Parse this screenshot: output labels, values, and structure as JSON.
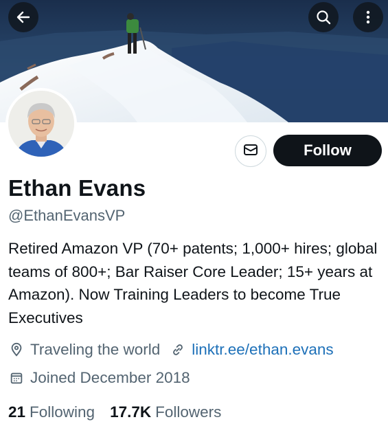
{
  "profile": {
    "name": "Ethan Evans",
    "handle": "@EthanEvansVP",
    "bio": "Retired Amazon VP (70+ patents; 1,000+ hires; global teams of 800+; Bar Raiser Core Leader; 15+ years at Amazon). Now Training Leaders to become True Executives",
    "location": "Traveling the world",
    "website": "linktr.ee/ethan.evans",
    "joined": "Joined December 2018"
  },
  "actions": {
    "follow_label": "Follow"
  },
  "stats": {
    "following_count": "21",
    "following_label": "Following",
    "followers_count": "17.7K",
    "followers_label": "Followers"
  },
  "icons": {
    "back": "arrow-left-icon",
    "search": "search-icon",
    "more": "more-vertical-icon",
    "message": "envelope-icon",
    "location": "location-pin-icon",
    "link": "link-icon",
    "calendar": "calendar-icon"
  },
  "colors": {
    "link": "#1d70b8",
    "secondary_text": "#536471",
    "primary_text": "#0f1419",
    "follow_button": "#0f1419"
  }
}
